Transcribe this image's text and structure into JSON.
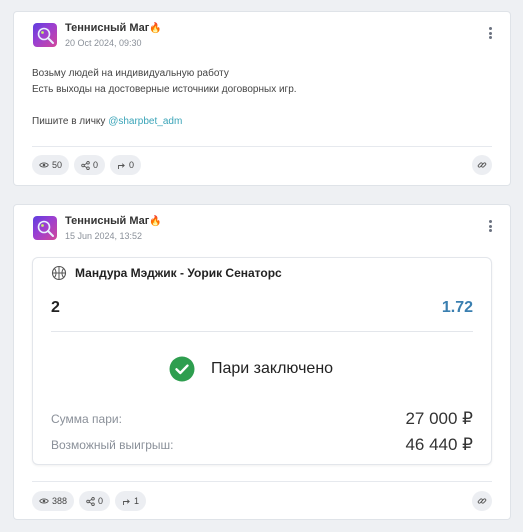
{
  "posts": [
    {
      "author": "Теннисный Маг",
      "author_emoji": "🔥",
      "date": "20 Oct 2024, 09:30",
      "text_lines": [
        "Возьму людей на индивидуальную работу",
        "Есть выходы на достоверные источники договорных игр.",
        "",
        "Пишите в личку "
      ],
      "mention": "@sharpbet_adm",
      "stats": {
        "views": "50",
        "shares": "0",
        "reposts": "0"
      }
    },
    {
      "author": "Теннисный Маг",
      "author_emoji": "🔥",
      "date": "15 Jun 2024, 13:52",
      "bet": {
        "match": "Мандура Мэджик - Уорик Сенаторс",
        "outcome": "2",
        "odds": "1.72",
        "status": "Пари заключено",
        "stake_label": "Сумма пари:",
        "stake_value": "27 000 ₽",
        "win_label": "Возможный выигрыш:",
        "win_value": "46 440 ₽"
      },
      "stats": {
        "views": "388",
        "shares": "0",
        "reposts": "1"
      }
    }
  ],
  "colors": {
    "accent": "#3a7fb0",
    "mention": "#3aa4b8",
    "success": "#2e9e4f"
  }
}
